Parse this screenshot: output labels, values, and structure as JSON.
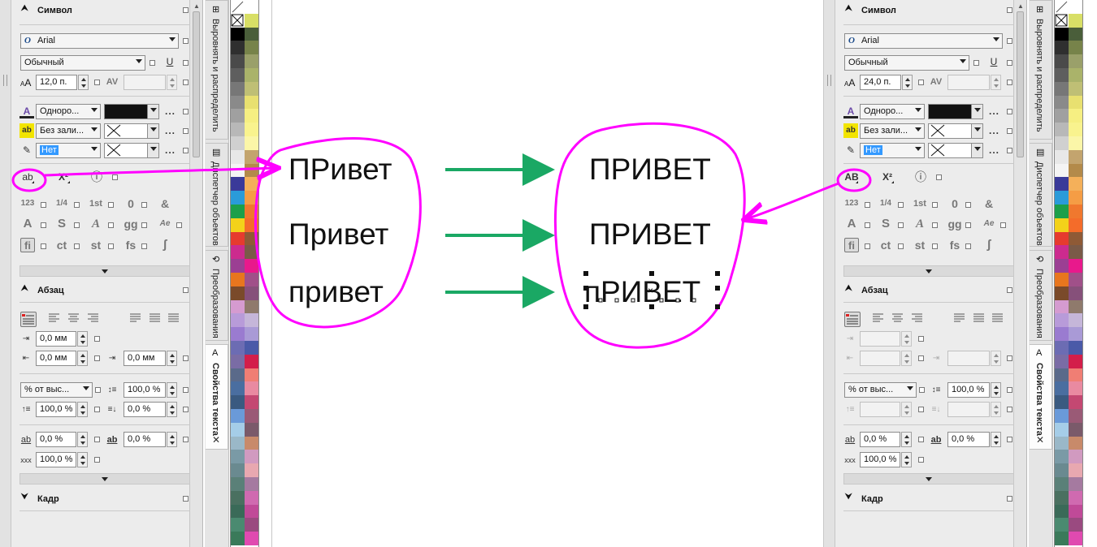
{
  "sections": {
    "symbol": "Символ",
    "paragraph": "Абзац",
    "frame": "Кадр"
  },
  "font": {
    "name": "Arial",
    "style": "Обычный",
    "glyph": "O"
  },
  "fill": {
    "type_short": "Одноро...",
    "bg_type": "Без зали...",
    "outline": "Нет"
  },
  "align_options": {
    "leading_unit": "% от выс..."
  },
  "left_panel": {
    "size": "12,0 п.",
    "indent_first": "0,0 мм",
    "indent_left": "0,0 мм",
    "indent_right": "0,0 мм",
    "line_spacing": "100,0 %",
    "before_para": "100,0 %",
    "after_para": "0,0 %",
    "char_spacing": "0,0 %",
    "word_spacing": "0,0 %",
    "lang_spacing": "100,0 %",
    "case_icon": "ab"
  },
  "right_panel": {
    "size": "24,0 п.",
    "line_spacing": "100,0 %",
    "char_spacing": "0,0 %",
    "word_spacing": "0,0 %",
    "lang_spacing": "100,0 %",
    "case_icon": "AB"
  },
  "icon_glyphs": {
    "kern": "AV",
    "underline": "U",
    "superscript": "X²",
    "circle_i": "ⓘ",
    "numstyle": "123",
    "fraction": "1/4",
    "ordinal": "1st",
    "zero": "0",
    "swash": "&",
    "alt_a": "A",
    "alt_s": "S",
    "script_a": "A",
    "gg": "gg",
    "ae": "Ae",
    "fi": "fi",
    "ct": "ct",
    "st": "st",
    "fs": "fs",
    "long_s": "ʃ",
    "spacing_ab": "ab",
    "spacing_ab2": "ab",
    "xxx": "xxx",
    "close": "✕",
    "fill_a": "A",
    "fill_ab": "ab"
  },
  "dock_tabs": [
    "Выровнять и распределить",
    "Диспетчер объектов",
    "Преобразования",
    "Свойства текста"
  ],
  "canvas_words": {
    "left": [
      "ПРивет",
      "Привет",
      "привет"
    ],
    "right": [
      "ПРИВЕТ",
      "ПРИВЕТ",
      "пРИВЕТ"
    ]
  },
  "colors": {
    "panel_bg": "#ececec",
    "highlight": "#ff00ff",
    "arrow": "#1aa864",
    "selection_blue": "#3399ff"
  },
  "palette": [
    [
      "#c8d44a",
      "#ffffff"
    ],
    [
      "#ffffff",
      "#d8df66"
    ],
    [
      "#000000",
      "#4a5e3a"
    ],
    [
      "#2f2f2f",
      "#77834a"
    ],
    [
      "#4a4a4a",
      "#9aa06a"
    ],
    [
      "#5e5e5e",
      "#aab36a"
    ],
    [
      "#777777",
      "#bfbf75"
    ],
    [
      "#8a8a8a",
      "#e8e070"
    ],
    [
      "#a0a0a0",
      "#f6ef82"
    ],
    [
      "#b8b8b8",
      "#f9f38e"
    ],
    [
      "#d0d0d0",
      "#fbf6a8"
    ],
    [
      "#e8e8e8",
      "#c3a46e"
    ],
    [
      "#f4f4f4",
      "#b38a4a"
    ],
    [
      "#3a3a99",
      "#f4b05a"
    ],
    [
      "#2a9bd9",
      "#f59d45"
    ],
    [
      "#1c9f4a",
      "#f0782e"
    ],
    [
      "#f3d21a",
      "#f46c2a"
    ],
    [
      "#e63b2e",
      "#8f5a36"
    ],
    [
      "#cc2b8e",
      "#7a5a48"
    ],
    [
      "#9b3f93",
      "#e8198c"
    ],
    [
      "#e8761e",
      "#a05089"
    ],
    [
      "#7a4a2a",
      "#86507a"
    ],
    [
      "#d59bd0",
      "#8f7a6c"
    ],
    [
      "#b89bd9",
      "#c5b6d9"
    ],
    [
      "#9a7bd0",
      "#a99ad6"
    ],
    [
      "#6c6cb3",
      "#4a5aa8"
    ],
    [
      "#7a6ca5",
      "#d31e4a"
    ],
    [
      "#5a6a8a",
      "#f07e74"
    ],
    [
      "#4a6ea0",
      "#e98aa1"
    ],
    [
      "#3a5a80",
      "#c44872"
    ],
    [
      "#6a9ad9",
      "#9a5a76"
    ],
    [
      "#a5cde8",
      "#7a5a6a"
    ],
    [
      "#9ab8c8",
      "#c88a6a"
    ],
    [
      "#7a9aa6",
      "#d19ac0"
    ],
    [
      "#6a8a90",
      "#e8a8b0"
    ],
    [
      "#5a8078",
      "#a57aa0"
    ],
    [
      "#4a7060",
      "#d06ab0"
    ],
    [
      "#3a6a58",
      "#c04a98"
    ],
    [
      "#4a8a70",
      "#9a4a80"
    ],
    [
      "#3a7a5a",
      "#e04ab0"
    ]
  ]
}
